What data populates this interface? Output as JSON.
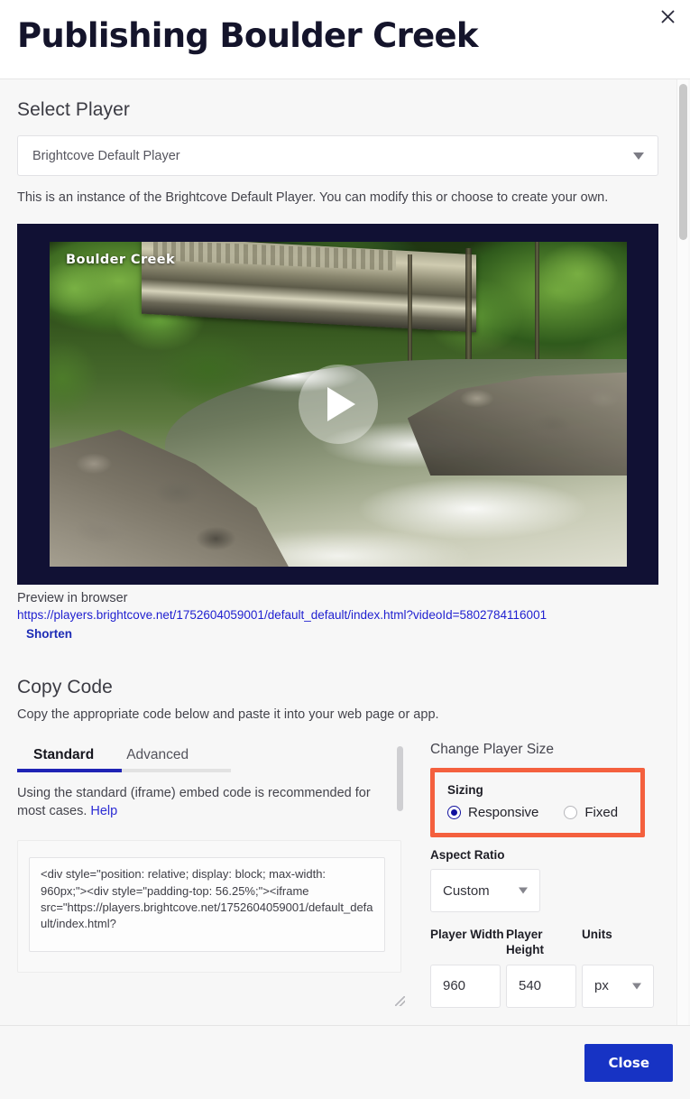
{
  "header": {
    "title": "Publishing Boulder Creek",
    "close_icon": "close-x-icon"
  },
  "select_player": {
    "heading": "Select Player",
    "selected_player": "Brightcove Default Player",
    "caret_icon": "chevron-down-icon",
    "description": "This is an instance of the Brightcove Default Player. You can modify this or choose to create your own."
  },
  "player_preview": {
    "video_title": "Boulder Creek",
    "play_icon": "play-triangle-icon",
    "preview_label": "Preview in browser",
    "preview_url": "https://players.brightcove.net/1752604059001/default_default/index.html?videoId=5802784116001",
    "shorten_label": "Shorten"
  },
  "copy_code": {
    "heading": "Copy Code",
    "description": "Copy the appropriate code below and paste it into your web page or app.",
    "tabs": [
      {
        "label": "Standard",
        "active": true
      },
      {
        "label": "Advanced",
        "active": false
      }
    ],
    "tab_description_prefix": "Using the standard (iframe) embed code is recommended for most cases. ",
    "help_link": "Help",
    "embed_code": "<div style=\"position: relative; display: block; max-width: 960px;\"><div style=\"padding-top: 56.25%;\"><iframe src=\"https://players.brightcove.net/1752604059001/default_default/index.html?"
  },
  "change_player_size": {
    "heading": "Change Player Size",
    "sizing_label": "Sizing",
    "sizing_options": [
      {
        "label": "Responsive",
        "selected": true
      },
      {
        "label": "Fixed",
        "selected": false
      }
    ],
    "aspect_ratio_label": "Aspect Ratio",
    "aspect_ratio_value": "Custom",
    "player_width_label": "Player Width",
    "player_height_label": "Player Height",
    "units_label": "Units",
    "player_width_value": "960",
    "player_height_value": "540",
    "units_value": "px"
  },
  "footer": {
    "close_label": "Close"
  },
  "colors": {
    "accent_blue": "#1733c4",
    "tab_active": "#1f23b5",
    "highlight_red": "#f4603e",
    "link_blue": "#1f1fd0",
    "player_bg": "#111134"
  }
}
